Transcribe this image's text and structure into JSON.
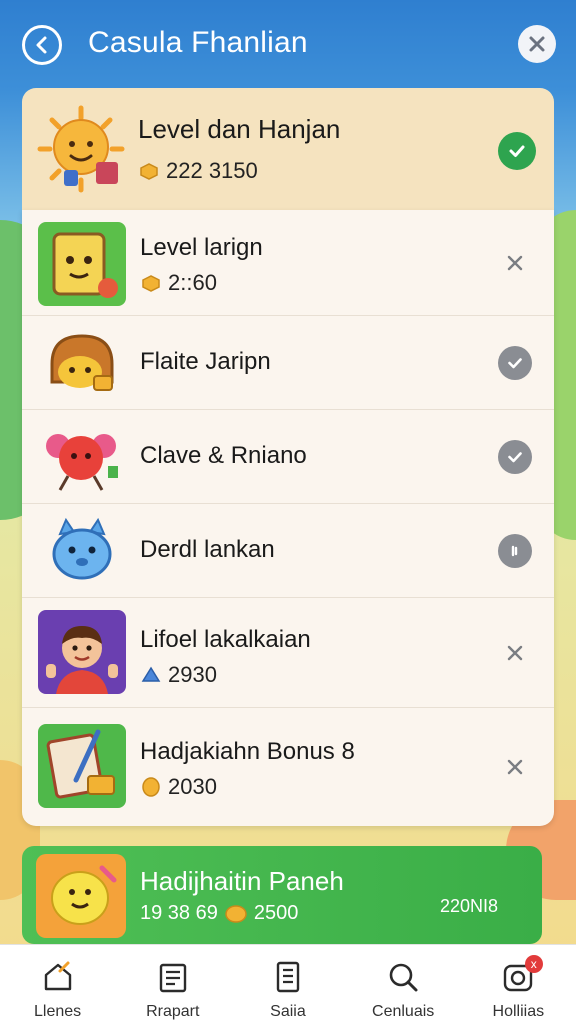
{
  "header": {
    "title": "Casula Fhanlian"
  },
  "top_item": {
    "name": "Level dan Hanjan",
    "score": "222 3150",
    "status": "checked"
  },
  "rows": [
    {
      "name": "Level larign",
      "score": "2::60",
      "action": "close",
      "score_icon": "coin-icon"
    },
    {
      "name": "Flaite Jaripn",
      "score": "",
      "action": "check"
    },
    {
      "name": "Clave & Rniano",
      "score": "",
      "action": "check"
    },
    {
      "name": "Derdl lankan",
      "score": "",
      "action": "mute"
    },
    {
      "name": "Lifoel lakalkaian",
      "score": "2930",
      "action": "close",
      "score_icon": "triangle-icon"
    },
    {
      "name": "Hadjakiahn Bonus 8",
      "score": "2030",
      "action": "close",
      "score_icon": "coin-icon"
    }
  ],
  "bonus": {
    "name": "Hadijhaitin Paneh",
    "score_left": "19 38 69",
    "score_mid": "2500",
    "score_right": "220NI8"
  },
  "nav": [
    {
      "label": "Llenes",
      "icon": "home-icon"
    },
    {
      "label": "Rrapart",
      "icon": "report-icon"
    },
    {
      "label": "Saiia",
      "icon": "document-icon"
    },
    {
      "label": "Cenluais",
      "icon": "search-icon"
    },
    {
      "label": "Holliias",
      "icon": "camera-icon",
      "badge": "x"
    }
  ],
  "colors": {
    "header_blue": "#2f7fd0",
    "success_green": "#2ea44f",
    "bonus_green": "#45b74e",
    "coin_gold": "#f2b233"
  }
}
